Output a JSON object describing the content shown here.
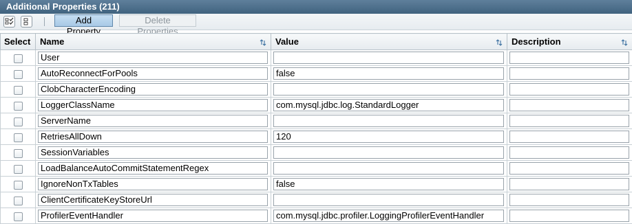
{
  "title": "Additional Properties (211)",
  "toolbar": {
    "select_all_icon": "select-all-icon",
    "deselect_all_icon": "deselect-all-icon",
    "add_label": "Add Property",
    "delete_label": "Delete Properties"
  },
  "columns": {
    "select": "Select",
    "name": "Name",
    "value": "Value",
    "description": "Description"
  },
  "rows": [
    {
      "name": "User",
      "value": "",
      "description": ""
    },
    {
      "name": "AutoReconnectForPools",
      "value": "false",
      "description": ""
    },
    {
      "name": "ClobCharacterEncoding",
      "value": "",
      "description": ""
    },
    {
      "name": "LoggerClassName",
      "value": "com.mysql.jdbc.log.StandardLogger",
      "description": ""
    },
    {
      "name": "ServerName",
      "value": "",
      "description": ""
    },
    {
      "name": "RetriesAllDown",
      "value": "120",
      "description": ""
    },
    {
      "name": "SessionVariables",
      "value": "",
      "description": ""
    },
    {
      "name": "LoadBalanceAutoCommitStatementRegex",
      "value": "",
      "description": ""
    },
    {
      "name": "IgnoreNonTxTables",
      "value": "false",
      "description": ""
    },
    {
      "name": "ClientCertificateKeyStoreUrl",
      "value": "",
      "description": ""
    },
    {
      "name": "ProfilerEventHandler",
      "value": "com.mysql.jdbc.profiler.LoggingProfilerEventHandler",
      "description": ""
    }
  ],
  "colors": {
    "title_bar": "#40637f",
    "add_button": "#a8c9e6",
    "sort_arrow": "#3a6fa0"
  }
}
